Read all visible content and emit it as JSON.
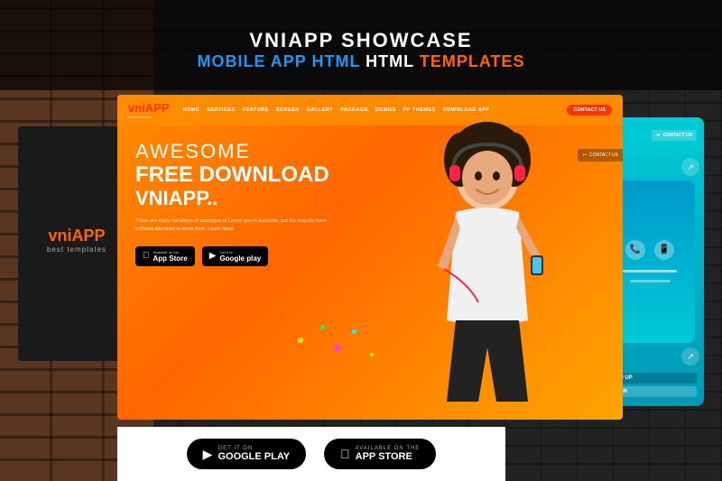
{
  "header": {
    "title": "VNIAPP SHOWCASE",
    "subtitle_blue": "MOBILE APP HTML",
    "subtitle_orange": "TEMPLATES"
  },
  "sidebar": {
    "logo": "vni",
    "logo_accent": "APP",
    "logo_sub": "best templates"
  },
  "main_card": {
    "nav_logo": "vni",
    "nav_logo_accent": "APP",
    "nav_logo_sub": "best templates",
    "nav_items": [
      "HOME",
      "SERVICES",
      "FEATURE",
      "SCREEN",
      "GALLERY",
      "PACKAGE",
      "DEMOS",
      "PP THEMES",
      "DOWNLOAD APP"
    ],
    "contact_btn": "CONTACT US",
    "hero_awesome": "AWESOME",
    "hero_free_download": "FREE DOWNLOAD",
    "hero_vniapp": "VNIAPP..",
    "hero_desc": "There are many variations of passages of Lorem Ipsum available, but the majority have suffered alteration in some form. Learn more",
    "appstore_available": "Available on the",
    "appstore_name": "App Store",
    "googleplay_available": "Get it on",
    "googleplay_name": "Google play"
  },
  "bottom_bar": {
    "google_play_small": "GOOGLE PLAY",
    "app_store_small": "APP STORE"
  },
  "right_card": {
    "contact_us": "CONTACT US",
    "sign_up": "SIGN UP",
    "login": "LOGIN"
  }
}
